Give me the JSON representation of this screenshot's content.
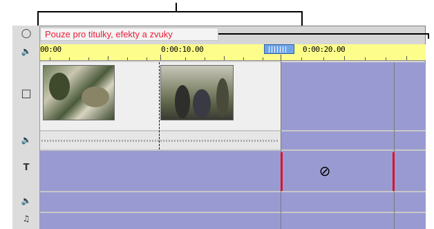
{
  "callout": {
    "text": "Pouze pro titulky, efekty a zvuky"
  },
  "ruler": {
    "labels": [
      "00:00",
      "0:00:10.00",
      "0:00:20.00"
    ]
  },
  "tracks": {
    "icons": [
      "video-track-icon",
      "audio-track-icon",
      "title-track-icon",
      "sound-effect-track-icon",
      "music-track-icon"
    ]
  },
  "colors": {
    "ruler_bg": "#fdfd8c",
    "restricted_area": "#9a9ad2",
    "callout_text": "#e8203a",
    "boundary_marker": "#e0102a"
  }
}
